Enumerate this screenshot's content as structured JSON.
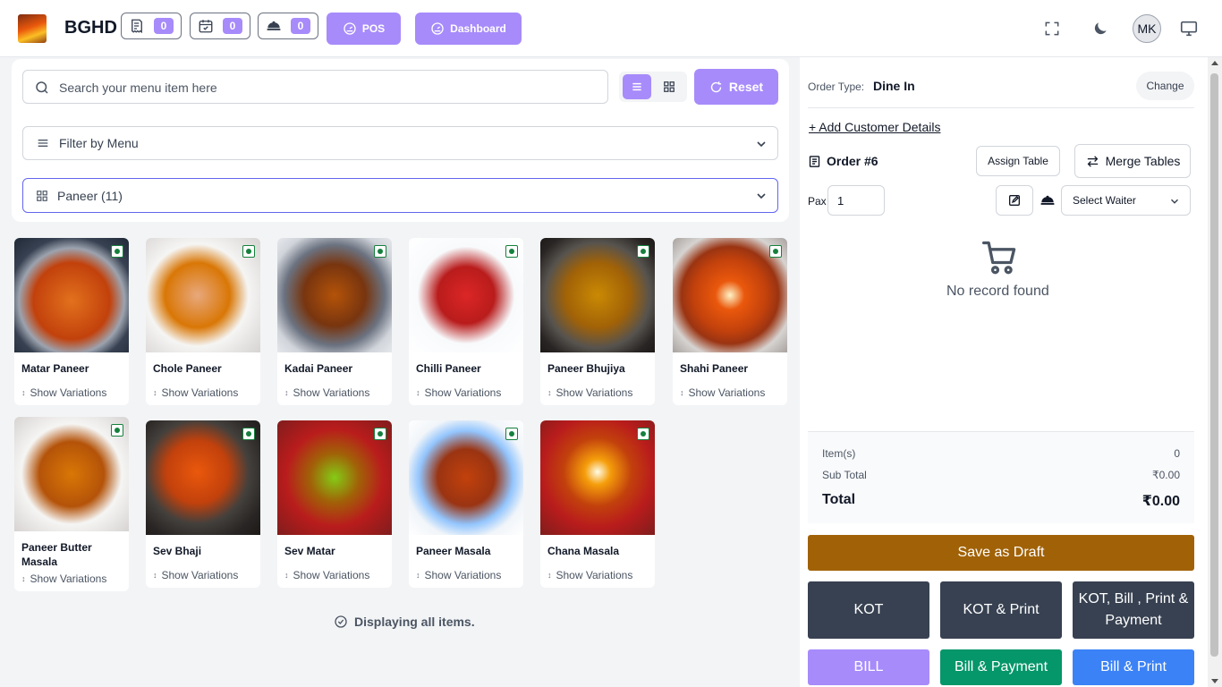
{
  "header": {
    "brand": "BGHD",
    "counters": [
      {
        "icon": "receipt-icon",
        "value": "0"
      },
      {
        "icon": "calendar-check-icon",
        "value": "0"
      },
      {
        "icon": "delivery-cloche-icon",
        "value": "0"
      }
    ],
    "pos_label": "POS",
    "dashboard_label": "Dashboard",
    "user_initials": "MK"
  },
  "filters": {
    "search_placeholder": "Search your menu item here",
    "reset_label": "Reset",
    "menu_filter_label": "Filter by Menu",
    "category_label": "Paneer (11)"
  },
  "items": [
    {
      "name": "Matar Paneer",
      "variations_label": "Show Variations",
      "veg": true
    },
    {
      "name": "Chole Paneer",
      "variations_label": "Show Variations",
      "veg": true
    },
    {
      "name": "Kadai Paneer",
      "variations_label": "Show Variations",
      "veg": true
    },
    {
      "name": "Chilli Paneer",
      "variations_label": "Show Variations",
      "veg": true
    },
    {
      "name": "Paneer Bhujiya",
      "variations_label": "Show Variations",
      "veg": true
    },
    {
      "name": "Shahi Paneer",
      "variations_label": "Show Variations",
      "veg": true
    },
    {
      "name": "Paneer Butter Masala",
      "variations_label": "Show Variations",
      "veg": true
    },
    {
      "name": "Sev Bhaji",
      "variations_label": "Show Variations",
      "veg": true
    },
    {
      "name": "Sev Matar",
      "variations_label": "Show Variations",
      "veg": true
    },
    {
      "name": "Paneer Masala",
      "variations_label": "Show Variations",
      "veg": true
    },
    {
      "name": "Chana Masala",
      "variations_label": "Show Variations",
      "veg": true
    }
  ],
  "footer_status": "Displaying all items.",
  "order": {
    "type_label": "Order Type:",
    "type_value": "Dine In",
    "change_label": "Change",
    "add_customer_label": "+ Add Customer Details",
    "order_number": "Order #6",
    "assign_table_label": "Assign Table",
    "merge_tables_label": "Merge Tables",
    "pax_label": "Pax",
    "pax_value": "1",
    "waiter_placeholder": "Select Waiter",
    "empty_text": "No record found",
    "summary": {
      "items_label": "Item(s)",
      "items_value": "0",
      "subtotal_label": "Sub Total",
      "subtotal_value": "₹0.00",
      "total_label": "Total",
      "total_value": "₹0.00"
    },
    "actions": {
      "save_draft": "Save as Draft",
      "kot": "KOT",
      "kot_print": "KOT & Print",
      "kot_bill_print_payment": "KOT, Bill , Print & Payment",
      "bill": "BILL",
      "bill_payment": "Bill & Payment",
      "bill_print": "Bill & Print"
    }
  },
  "colors": {
    "accent": "#a78bfa",
    "draft": "#a16207",
    "dark": "#374151",
    "bill_payment": "#059669",
    "bill_print": "#3b82f6",
    "veg": "#15803d"
  }
}
